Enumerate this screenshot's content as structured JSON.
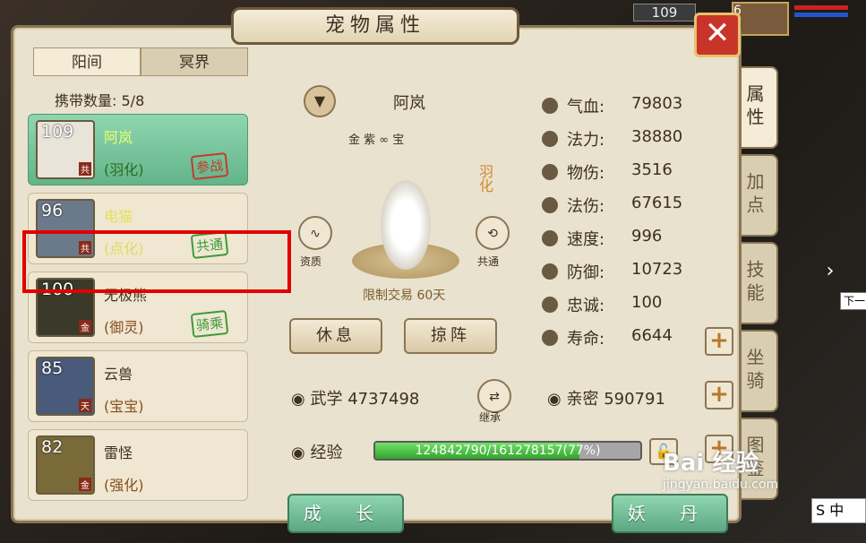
{
  "window": {
    "title": "宠物属性",
    "close_label": "✕"
  },
  "topbar": {
    "level_chip": "109",
    "player_level": "6"
  },
  "realm_tabs": [
    "阳间",
    "冥界"
  ],
  "carry": {
    "label": "携带数量:",
    "value": "5/8"
  },
  "pets": [
    {
      "level": "109",
      "name": "阿岚",
      "type": "(羽化)",
      "badge": "共",
      "stamp": "参战",
      "stamp_color": "red"
    },
    {
      "level": "96",
      "name": "电猫",
      "type": "(点化)",
      "badge": "共",
      "stamp": "共通",
      "stamp_color": "green"
    },
    {
      "level": "100",
      "name": "无极熊",
      "type": "(御灵)",
      "badge": "金",
      "stamp": "骑乘",
      "stamp_color": "green"
    },
    {
      "level": "85",
      "name": "云兽",
      "type": "(宝宝)",
      "badge": "天",
      "stamp": ""
    },
    {
      "level": "82",
      "name": "雷怪",
      "type": "(强化)",
      "badge": "金",
      "stamp": ""
    }
  ],
  "selected_pet": {
    "name": "阿岚",
    "icons": "金 紫 ∞ 宝",
    "yuhua_label": "羽化",
    "aptitude_label": "资质",
    "common_label": "共通",
    "trade_limit": "限制交易 60天",
    "rest_button": "休息",
    "formation_button": "掠阵"
  },
  "stats": [
    {
      "label": "气血:",
      "value": "79803"
    },
    {
      "label": "法力:",
      "value": "38880"
    },
    {
      "label": "物伤:",
      "value": "3516"
    },
    {
      "label": "法伤:",
      "value": "67615"
    },
    {
      "label": "速度:",
      "value": "996"
    },
    {
      "label": "防御:",
      "value": "10723"
    },
    {
      "label": "忠诚:",
      "value": "100"
    },
    {
      "label": "寿命:",
      "value": "6644"
    }
  ],
  "martial": {
    "label": "武学",
    "value": "4737498"
  },
  "inherit_label": "继承",
  "intimacy": {
    "label": "亲密",
    "value": "590791"
  },
  "experience": {
    "label": "经验",
    "text": "124842790/161278157(77%)",
    "fraction": 0.77
  },
  "plus_label": "+",
  "grow_button": "成 长",
  "yaodan_button": "妖 丹",
  "side_tabs": [
    "属性",
    "加点",
    "技能",
    "坐骑",
    "图鉴"
  ],
  "next_tooltip": "下一",
  "watermark": {
    "main": "Bai 经验",
    "sub": "jingyan.baidu.com"
  },
  "ime": "S 中"
}
